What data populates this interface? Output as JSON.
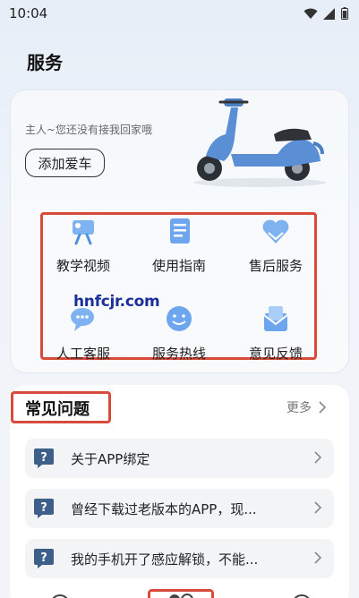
{
  "status_bar": {
    "time": "10:04",
    "icons": [
      "wifi-icon",
      "signal-icon",
      "battery-icon"
    ]
  },
  "page": {
    "title": "服务"
  },
  "vehicle": {
    "prompt": "主人~您还没有接我回家哦",
    "add_button": "添加爱车"
  },
  "services": [
    {
      "label": "教学视频",
      "icon": "video-icon"
    },
    {
      "label": "使用指南",
      "icon": "guide-book-icon"
    },
    {
      "label": "售后服务",
      "icon": "heart-service-icon"
    },
    {
      "label": "人工客服",
      "icon": "chat-bubble-icon"
    },
    {
      "label": "服务热线",
      "icon": "smile-hotline-icon"
    },
    {
      "label": "意见反馈",
      "icon": "feedback-envelope-icon"
    }
  ],
  "watermark": "hnfcjr.com",
  "faq": {
    "title": "常见问题",
    "more": "更多",
    "items": [
      "关于APP绑定",
      "曾经下载过老版本的APP，现...",
      "我的手机开了感应解锁，不能..."
    ]
  },
  "colors": {
    "accent_red": "#d84a3a",
    "icon_blue": "#5a9be8",
    "scooter_blue": "#5a8fd6"
  }
}
